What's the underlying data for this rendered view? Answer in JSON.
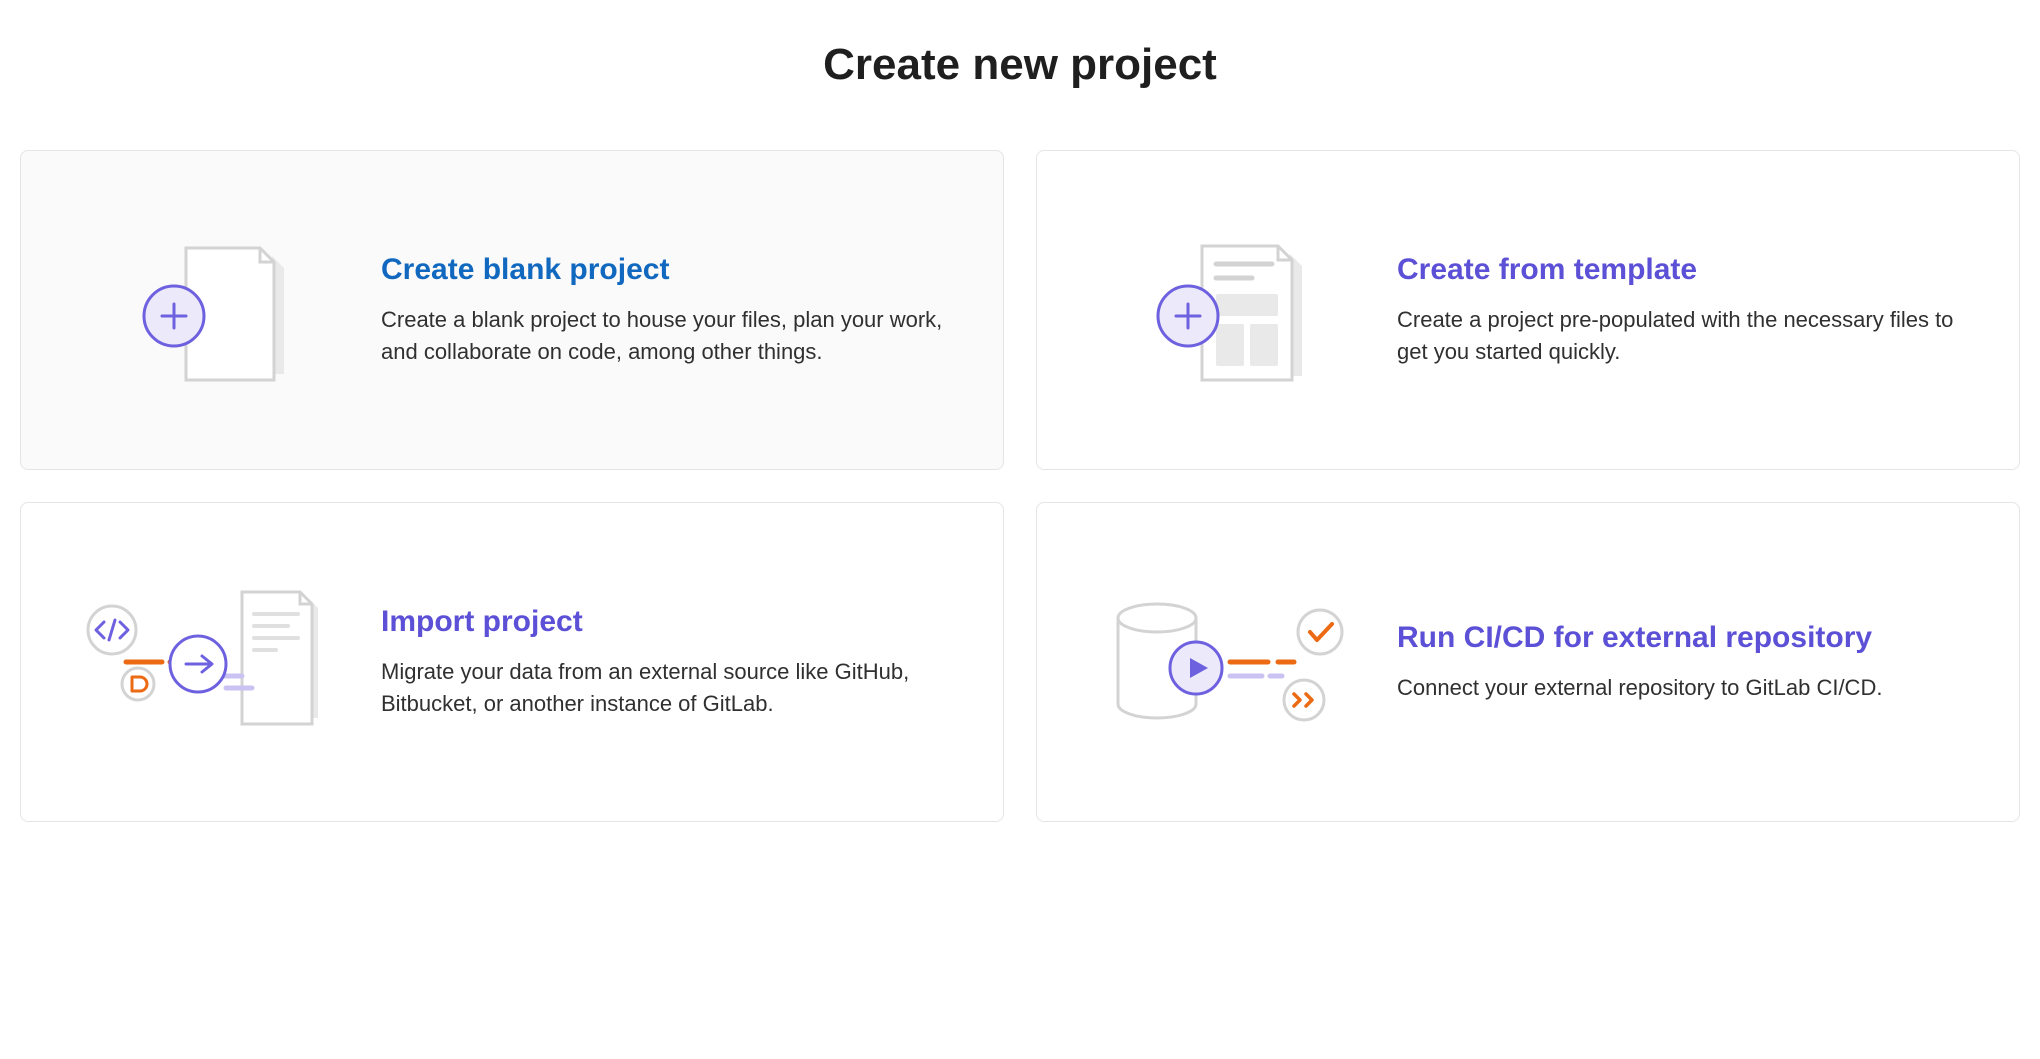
{
  "page": {
    "title": "Create new project"
  },
  "cards": {
    "blank": {
      "title": "Create blank project",
      "description": "Create a blank project to house your files, plan your work, and collaborate on code, among other things."
    },
    "template": {
      "title": "Create from template",
      "description": "Create a project pre-populated with the necessary files to get you started quickly."
    },
    "import": {
      "title": "Import project",
      "description": "Migrate your data from an external source like GitHub, Bitbucket, or another instance of GitLab."
    },
    "cicd": {
      "title": "Run CI/CD for external repository",
      "description": "Connect your external repository to GitLab CI/CD."
    }
  }
}
